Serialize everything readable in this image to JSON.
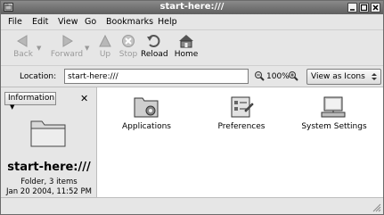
{
  "window": {
    "title": "start-here:///"
  },
  "menu": {
    "items": [
      {
        "label": "File"
      },
      {
        "label": "Edit"
      },
      {
        "label": "View"
      },
      {
        "label": "Go"
      },
      {
        "label": "Bookmarks"
      },
      {
        "label": "Help"
      }
    ]
  },
  "toolbar": {
    "back": "Back",
    "forward": "Forward",
    "up": "Up",
    "stop": "Stop",
    "reload": "Reload",
    "home": "Home"
  },
  "location": {
    "label": "Location:",
    "value": "start-here:///",
    "zoom": "100%",
    "view_mode": "View as Icons"
  },
  "sidepane": {
    "selector": "Information",
    "title": "start-here:///",
    "info": "Folder, 3 items",
    "date": "Jan 20 2004, 11:52 PM"
  },
  "content": {
    "items": [
      {
        "label": "Applications",
        "icon": "applications-folder-icon"
      },
      {
        "label": "Preferences",
        "icon": "preferences-icon"
      },
      {
        "label": "System Settings",
        "icon": "system-settings-icon"
      }
    ]
  },
  "colors": {
    "titlebar": "#6e6e6e",
    "window_bg": "#e6e6e6",
    "content_bg": "#ffffff"
  }
}
